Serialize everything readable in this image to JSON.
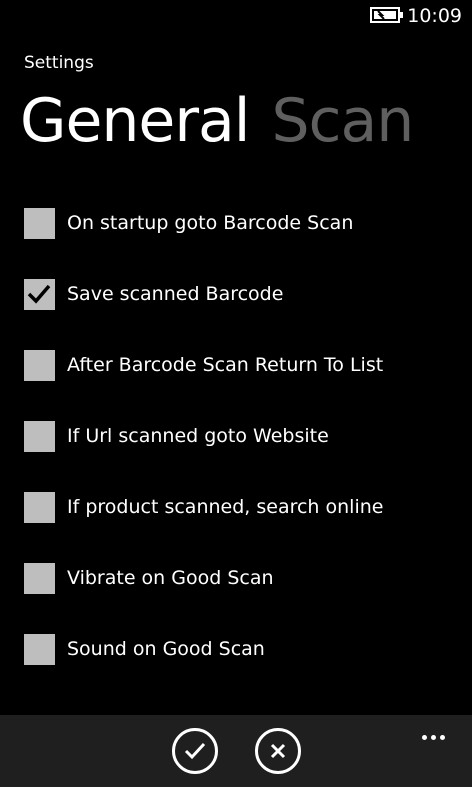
{
  "status_bar": {
    "time": "10:09",
    "battery_icon": "battery-charging-icon"
  },
  "app": {
    "title": "Settings"
  },
  "pivot": {
    "active": "General",
    "inactive": "Scan"
  },
  "options": [
    {
      "label": "On startup goto Barcode Scan",
      "checked": false
    },
    {
      "label": "Save scanned Barcode",
      "checked": true
    },
    {
      "label": "After Barcode Scan Return To List",
      "checked": false
    },
    {
      "label": "If Url scanned goto Website",
      "checked": false
    },
    {
      "label": "If product scanned, search online",
      "checked": false
    },
    {
      "label": "Vibrate on Good Scan",
      "checked": false
    },
    {
      "label": "Sound on Good Scan",
      "checked": false
    }
  ],
  "app_bar": {
    "ok_icon": "check-icon",
    "cancel_icon": "close-icon",
    "more_icon": "ellipsis-icon"
  },
  "colors": {
    "background": "#000000",
    "checkbox": "#bebebe",
    "inactive_pivot": "#5f5f5f",
    "app_bar": "#1f1f1f"
  }
}
